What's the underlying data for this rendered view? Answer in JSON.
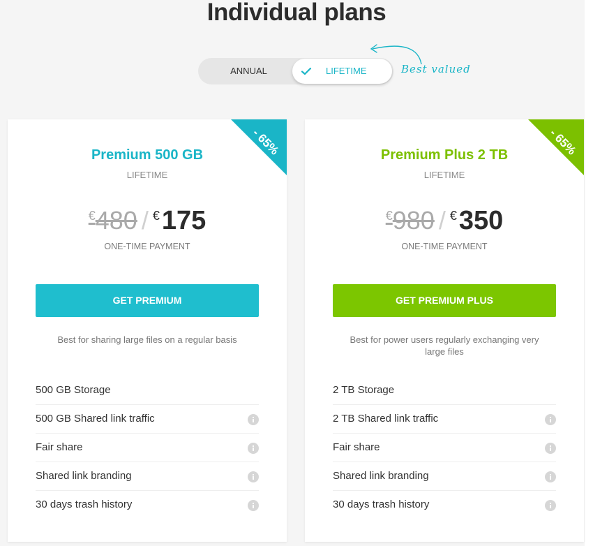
{
  "page": {
    "title": "Individual plans",
    "accent_teal": "#1ab5c7",
    "accent_green": "#7cc000"
  },
  "toggle": {
    "options": [
      "ANNUAL",
      "LIFETIME"
    ],
    "selected": "LIFETIME",
    "annotation": "Best valued"
  },
  "plans": [
    {
      "name": "Premium 500 GB",
      "period": "LIFETIME",
      "badge": "- 65%",
      "old_price": "480",
      "new_price": "175",
      "currency": "€",
      "payment_note": "ONE-TIME PAYMENT",
      "cta": "GET PREMIUM",
      "description": "Best for sharing large files on a regular basis",
      "color": "#1ab5c7",
      "features": [
        {
          "label": "500 GB Storage",
          "info": false
        },
        {
          "label": "500 GB Shared link traffic",
          "info": true
        },
        {
          "label": "Fair share",
          "info": true
        },
        {
          "label": "Shared link branding",
          "info": true
        },
        {
          "label": "30 days trash history",
          "info": true
        }
      ]
    },
    {
      "name": "Premium Plus 2 TB",
      "period": "LIFETIME",
      "badge": "- 65%",
      "old_price": "980",
      "new_price": "350",
      "currency": "€",
      "payment_note": "ONE-TIME PAYMENT",
      "cta": "GET PREMIUM PLUS",
      "description": "Best for power users regularly exchanging very large files",
      "color": "#7cc000",
      "features": [
        {
          "label": "2 TB Storage",
          "info": false
        },
        {
          "label": "2 TB Shared link traffic",
          "info": true
        },
        {
          "label": "Fair share",
          "info": true
        },
        {
          "label": "Shared link branding",
          "info": true
        },
        {
          "label": "30 days trash history",
          "info": true
        }
      ]
    }
  ]
}
